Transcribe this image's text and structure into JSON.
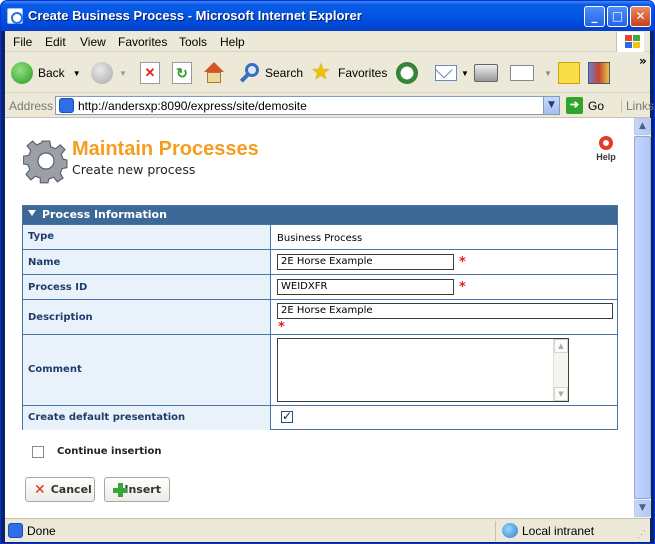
{
  "window": {
    "title": "Create Business Process - Microsoft Internet Explorer",
    "minimize_glyph": "_",
    "maximize_glyph": "□",
    "close_glyph": "✕"
  },
  "menu": [
    "File",
    "Edit",
    "View",
    "Favorites",
    "Tools",
    "Help"
  ],
  "toolbar": {
    "back_label": "Back",
    "search_label": "Search",
    "favorites_label": "Favorites"
  },
  "address": {
    "label": "Address",
    "url": "http://andersxp:8090/express/site/demosite",
    "go_label": "Go",
    "links_label": "Links"
  },
  "header": {
    "title": "Maintain Processes",
    "subtitle": "Create new process",
    "help_label": "Help"
  },
  "section": {
    "title": "Process Information",
    "rows": {
      "type": {
        "label": "Type",
        "value": "Business Process"
      },
      "name": {
        "label": "Name",
        "value": "2E Horse Example"
      },
      "process_id": {
        "label": "Process ID",
        "value": "WEIDXFR"
      },
      "description": {
        "label": "Description",
        "value": "2E Horse Example"
      },
      "comment": {
        "label": "Comment",
        "value": ""
      },
      "default_presentation": {
        "label": "Create default presentation",
        "checked": true
      }
    },
    "required_marker": "*"
  },
  "continue_insertion": {
    "label": "Continue insertion",
    "checked": false
  },
  "buttons": {
    "cancel": "Cancel",
    "insert": "Insert"
  },
  "status": {
    "text": "Done",
    "zone": "Local intranet"
  }
}
